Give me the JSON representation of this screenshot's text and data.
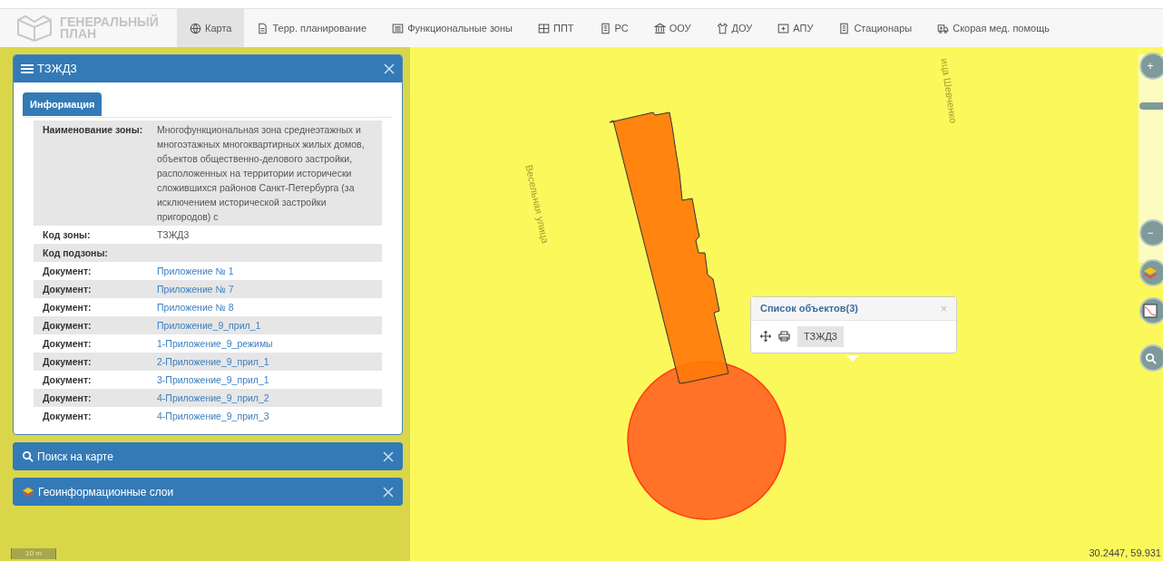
{
  "logo": {
    "line1": "ГЕНЕРАЛЬНЫЙ",
    "line2": "ПЛАН"
  },
  "nav": [
    {
      "label": "Карта",
      "selected": true
    },
    {
      "label": "Терр. планирование",
      "selected": false
    },
    {
      "label": "Функциональные зоны",
      "selected": false
    },
    {
      "label": "ППТ",
      "selected": false
    },
    {
      "label": "РС",
      "selected": false
    },
    {
      "label": "ООУ",
      "selected": false
    },
    {
      "label": "ДОУ",
      "selected": false
    },
    {
      "label": "АПУ",
      "selected": false
    },
    {
      "label": "Стационары",
      "selected": false
    },
    {
      "label": "Скорая мед. помощь",
      "selected": false
    }
  ],
  "info_panel": {
    "title": "ТЗЖД3",
    "tab": "Информация",
    "rows": [
      {
        "label": "Наименование зоны:",
        "value": "Многофункциональная зона среднеэтажных и многоэтажных многоквартирных жилых домов, объектов общественно-делового застройки, расположенных на территории исторически сложившихся районов Санкт-Петербурга (за исключением исторической застройки пригородов) с",
        "kind": "text"
      },
      {
        "label": "Код зоны:",
        "value": "ТЗЖД3",
        "kind": "text"
      },
      {
        "label": "Код подзоны:"
      },
      {
        "label": "Документ:",
        "value": "Приложение № 1",
        "kind": "link"
      },
      {
        "label": "Документ:",
        "value": "Приложение № 7",
        "kind": "link"
      },
      {
        "label": "Документ:",
        "value": "Приложение № 8",
        "kind": "link"
      },
      {
        "label": "Документ:",
        "value": "Приложение_9_прил_1",
        "kind": "link"
      },
      {
        "label": "Документ:",
        "value": "1-Приложение_9_режимы",
        "kind": "link"
      },
      {
        "label": "Документ:",
        "value": "2-Приложение_9_прил_1",
        "kind": "link"
      },
      {
        "label": "Документ:",
        "value": "3-Приложение_9_прил_1",
        "kind": "link"
      },
      {
        "label": "Документ:",
        "value": "4-Приложение_9_прил_2",
        "kind": "link"
      },
      {
        "label": "Документ:",
        "value": "4-Приложение_9_прил_3",
        "kind": "link"
      }
    ]
  },
  "collapsed_panels": [
    {
      "title": "Поиск на карте"
    },
    {
      "title": "Геоинформационные слои"
    }
  ],
  "map": {
    "street_labels": [
      "Весельная улица",
      "ица Шевченко"
    ],
    "scale": "10 m",
    "coordinates": "30.2447, 59.931"
  },
  "popup": {
    "title": "Список объектов(3)",
    "close": "×",
    "item": "ТЗЖД3"
  },
  "map_controls": [
    {
      "kind": "zoom-in",
      "label": "+"
    },
    {
      "kind": "zoom-out",
      "label": "−"
    },
    {
      "kind": "layers"
    },
    {
      "kind": "legend"
    },
    {
      "kind": "search"
    }
  ]
}
